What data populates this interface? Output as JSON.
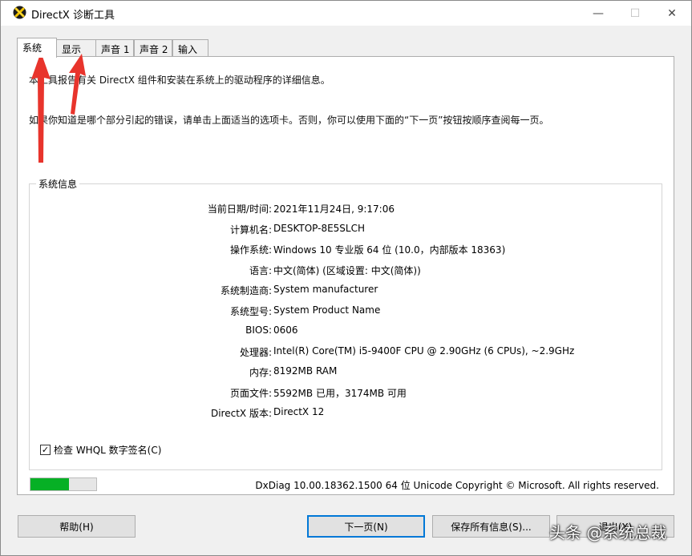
{
  "window": {
    "title": "DirectX 诊断工具",
    "controls": {
      "minimize": "—",
      "maximize": "☐",
      "close": "✕"
    }
  },
  "tabs": [
    {
      "label": "系统",
      "active": true
    },
    {
      "label": "显示",
      "active": false
    },
    {
      "label": "声音 1",
      "active": false
    },
    {
      "label": "声音 2",
      "active": false
    },
    {
      "label": "输入",
      "active": false
    }
  ],
  "description": {
    "line1": "本工具报告有关 DirectX 组件和安装在系统上的驱动程序的详细信息。",
    "line2": "如果你知道是哪个部分引起的错误，请单击上面适当的选项卡。否则，你可以使用下面的“下一页”按钮按顺序查阅每一页。"
  },
  "system_info": {
    "legend": "系统信息",
    "rows": [
      {
        "label": "当前日期/时间:",
        "value": "2021年11月24日, 9:17:06"
      },
      {
        "label": "计算机名:",
        "value": "DESKTOP-8E5SLCH"
      },
      {
        "label": "操作系统:",
        "value": "Windows 10 专业版 64 位 (10.0，内部版本 18363)"
      },
      {
        "label": "语言:",
        "value": "中文(简体) (区域设置: 中文(简体))"
      },
      {
        "label": "系统制造商:",
        "value": "System manufacturer"
      },
      {
        "label": "系统型号:",
        "value": "System Product Name"
      },
      {
        "label": "BIOS:",
        "value": "0606"
      },
      {
        "label": "处理器:",
        "value": "Intel(R) Core(TM) i5-9400F CPU @ 2.90GHz (6 CPUs), ~2.9GHz"
      },
      {
        "label": "内存:",
        "value": "8192MB RAM"
      },
      {
        "label": "页面文件:",
        "value": "5592MB 已用，3174MB 可用"
      },
      {
        "label": "DirectX 版本:",
        "value": "DirectX 12"
      }
    ]
  },
  "whql": {
    "label": "检查 WHQL 数字签名(C)",
    "checked": true,
    "check_mark": "✓"
  },
  "progress": {
    "value": 0.58,
    "color": "#06b025"
  },
  "footer": {
    "version_text": "DxDiag 10.00.18362.1500 64 位 Unicode  Copyright © Microsoft. All rights reserved."
  },
  "buttons": {
    "help": "帮助(H)",
    "next": "下一页(N)",
    "save": "保存所有信息(S)...",
    "exit": "退出(X)"
  },
  "watermark": "头条 @系统总裁",
  "colors": {
    "accent": "#0078d7",
    "arrow": "#e8342c"
  }
}
